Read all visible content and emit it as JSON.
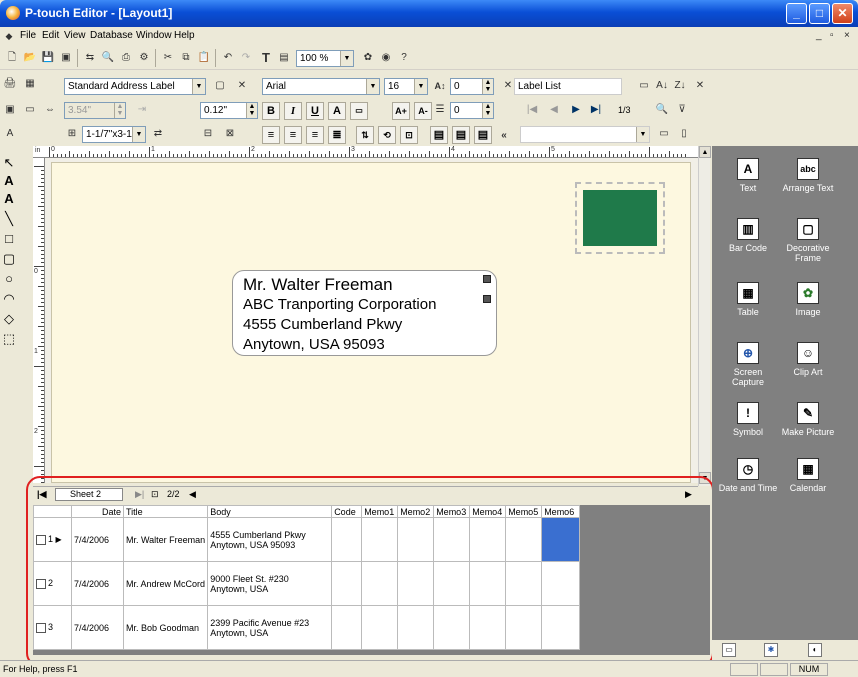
{
  "window": {
    "title": "P-touch Editor - [Layout1]"
  },
  "menu": [
    "File",
    "Edit",
    "View",
    "Database",
    "Window",
    "Help"
  ],
  "toolbar": {
    "zoom": "100 %",
    "paper": "Standard Address Label",
    "length": "3.54\"",
    "margin": "0.12\"",
    "tape_size": "1-1/7\"x3-1/2\"",
    "font": "Arial",
    "font_size": "16",
    "char_spacing": "0",
    "line_spacing": "0",
    "label_list": "Label List",
    "page_counter": "1/3",
    "bold": "B",
    "italic": "I",
    "underline": "U",
    "text_tool": "T"
  },
  "ruler": {
    "unit": "in",
    "h_numbers": [
      "0",
      "1",
      "2",
      "3",
      "4",
      "5"
    ],
    "v_numbers": [
      "0",
      "1",
      "2"
    ]
  },
  "label": {
    "lines": [
      "Mr. Walter Freeman",
      "ABC Tranporting Corporation",
      "4555 Cumberland Pkwy",
      "Anytown, USA 95093"
    ]
  },
  "sheet": {
    "name": "Sheet 2",
    "counter": "2/2"
  },
  "database": {
    "columns": [
      "Date",
      "Title",
      "Body",
      "Code",
      "Memo1",
      "Memo2",
      "Memo3",
      "Memo4",
      "Memo5",
      "Memo6"
    ],
    "rows": [
      {
        "num": "1",
        "date": "7/4/2006",
        "title": "Mr. Walter Freeman",
        "body1": "4555 Cumberland Pkwy",
        "body2": "Anytown, USA 95093"
      },
      {
        "num": "2",
        "date": "7/4/2006",
        "title": "Mr. Andrew McCord",
        "body1": "9000 Fleet St. #230",
        "body2": "Anytown, USA"
      },
      {
        "num": "3",
        "date": "7/4/2006",
        "title": "Mr. Bob Goodman",
        "body1": "2399 Pacific Avenue #23",
        "body2": "Anytown, USA"
      }
    ]
  },
  "right_panel": {
    "items": [
      {
        "label": "Text",
        "icon": "text-icon"
      },
      {
        "label": "Arrange Text",
        "icon": "arrange-text-icon"
      },
      {
        "label": "Bar Code",
        "icon": "barcode-icon"
      },
      {
        "label": "Decorative Frame",
        "icon": "frame-icon"
      },
      {
        "label": "Table",
        "icon": "table-icon"
      },
      {
        "label": "Image",
        "icon": "image-icon"
      },
      {
        "label": "Screen Capture",
        "icon": "screen-capture-icon"
      },
      {
        "label": "Clip Art",
        "icon": "clipart-icon"
      },
      {
        "label": "Symbol",
        "icon": "symbol-icon"
      },
      {
        "label": "Make Picture",
        "icon": "make-picture-icon"
      },
      {
        "label": "Date and Time",
        "icon": "datetime-icon"
      },
      {
        "label": "Calendar",
        "icon": "calendar-icon"
      }
    ]
  },
  "status": {
    "help": "For Help, press F1",
    "num": "NUM"
  },
  "colors": {
    "stamp": "#1f7a4a",
    "highlight": "#e02020",
    "selected_cell": "#3a6fd0"
  }
}
